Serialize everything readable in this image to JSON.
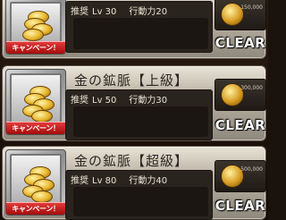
{
  "cards": [
    {
      "title": "",
      "recommend_label": "推奨",
      "level": "Lv 30",
      "action_label": "行動力",
      "action_cost": "20",
      "campaign": "キャンペーン！",
      "reward_amount": "150,000",
      "status": "CLEAR"
    },
    {
      "title": "金の鉱脈【上級】",
      "recommend_label": "推奨",
      "level": "Lv 50",
      "action_label": "行動力",
      "action_cost": "30",
      "campaign": "キャンペーン！",
      "reward_amount": "300,000",
      "status": "CLEAR"
    },
    {
      "title": "金の鉱脈【超級】",
      "recommend_label": "推奨",
      "level": "Lv 80",
      "action_label": "行動力",
      "action_cost": "40",
      "campaign": "キャンペーン！",
      "reward_amount": "500,000",
      "status": "CLEAR"
    }
  ],
  "icons": {
    "thumbnail": "gold-coins-icon",
    "reward": "gold-coin-icon"
  },
  "colors": {
    "campaign_red": "#c41a1a",
    "clear_text": "#ffffff",
    "panel_dark": "#2a241e"
  }
}
